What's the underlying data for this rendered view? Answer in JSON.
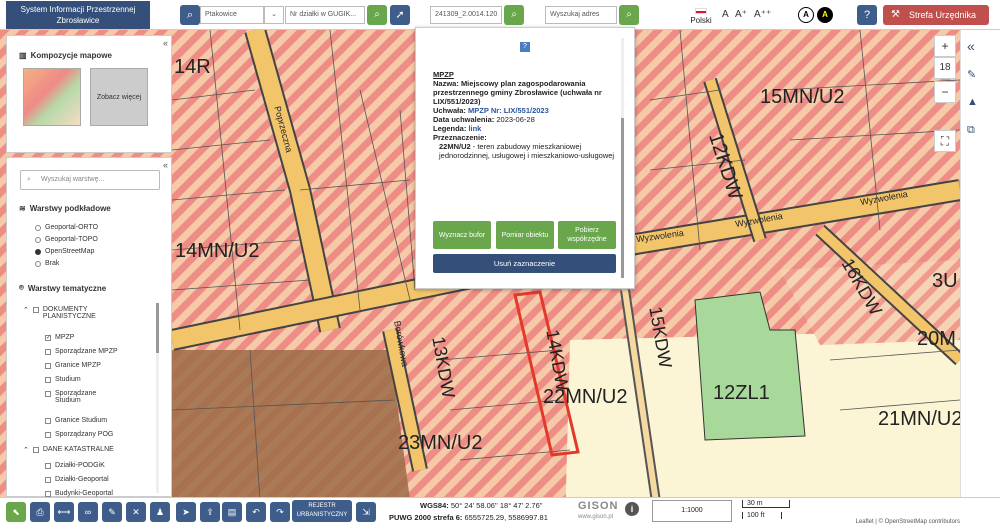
{
  "header": {
    "title_line1": "System Informacji Przestrzennej",
    "title_line2": "Zbrosławice",
    "locality": "Ptakowice",
    "parcel_placeholder": "Nr działki w GUGIK...",
    "parcel_id": "241309_2.0014.120",
    "address_placeholder": "Wyszukaj adres",
    "language": "Polski",
    "font_small": "A",
    "font_medium": "A⁺",
    "font_large": "A⁺⁺",
    "contrast_a": "A",
    "contrast_b": "A",
    "help_label": "?",
    "strefa_label": "Strefa Urzędnika"
  },
  "left_panel": {
    "compositions_title": "Kompozycje mapowe",
    "see_more": "Zobacz więcej",
    "layer_search_placeholder": "Wyszukaj warstwę...",
    "base_layers_title": "Warstwy podkładowe",
    "base_layers": [
      "Geoportal-ORTO",
      "Geoportal-TOPO",
      "OpenStreetMap",
      "Brak"
    ],
    "selected_base": 2,
    "thematic_title": "Warstwy tematyczne",
    "group_docs": "DOKUMENTY PLANISTYCZNE",
    "doc_layers": [
      "MPZP",
      "Sporządzane MPZP",
      "Granice MPZP",
      "Studium",
      "Sporządzane Studium",
      "Granice Studium",
      "Sporządzany POG"
    ],
    "group_cadastre": "DANE KATASTRALNE",
    "cadastre_layers": [
      "Działki-PODGiK",
      "Działki-Geoportal",
      "Budynki-Geoportal"
    ]
  },
  "popup": {
    "heading": "MPZP",
    "name_label": "Nazwa:",
    "name_value": "Miejscowy plan zagospodarowania przestrzennego gminy Zbrosławice (uchwała nr LIX/551/2023)",
    "resolution_label": "Uchwała:",
    "resolution_value": "MPZP Nr: LIX/551/2023",
    "date_label": "Data uchwalenia:",
    "date_value": "2023-06-28",
    "legend_label": "Legenda:",
    "legend_link": "link",
    "purpose_label": "Przeznaczenie:",
    "purpose_code": "22MN/U2",
    "purpose_text": " - teren zabudowy mieszkaniowej jednorodzinnej, usługowej i mieszkaniowo-usługowej",
    "btn_buffer": "Wyznacz bufor",
    "btn_measure": "Pomiar obiektu",
    "btn_coords": "Pobierz współrzędne",
    "btn_clear": "Usuń zaznaczenie"
  },
  "map_labels": {
    "z14r": "14R",
    "z15mnu2": "15MN/U2",
    "z12kdw": "12KDW",
    "z14mnu2": "14MN/U2",
    "z16kdw": "16KDW",
    "z3u": "3U",
    "z13kdw": "13KDW",
    "z15kdw": "15KDW",
    "z20m": "20M",
    "z14kdw": "14KDW",
    "z22mnu2": "22MN/U2",
    "z12zl1": "12ZL1",
    "z21mnu2": "21MN/U2",
    "z23mnu2": "23MN/U2",
    "street_poprzeczna": "Poprzeczna",
    "street_wyzwolenia1": "Wyzwolenia",
    "street_wyzwolenia2": "Wyzwolenia",
    "street_wyzwolenia3": "Wyzwolenia",
    "street_borowkowa": "Borówkowa"
  },
  "right_bar": {
    "zoom_in": "+",
    "zoom_level": "18",
    "zoom_out": "−"
  },
  "bottom": {
    "rejestr": "REJESTR URBANISTYCZNY",
    "wgs_label": "WGS84:",
    "wgs_value": "50° 24' 58.06'' 18° 47' 2.76''",
    "puwg_label": "PUWG 2000 strefa 6:",
    "puwg_value": "6555725.29, 5586997.81",
    "gison": "GISON",
    "gison_url": "www.gison.pl",
    "scale": "1:1000",
    "scale_m": "30 m",
    "scale_ft": "100 ft",
    "attribution": "Leaflet | © OpenStreetMap contributors"
  },
  "colors": {
    "primary": "#34507a",
    "green": "#6aa64b",
    "red": "#c0504d",
    "residential_stripe": "#ef8a86",
    "forest": "#a8d89a",
    "field": "#fbf6d7",
    "service": "#9c6b45"
  }
}
